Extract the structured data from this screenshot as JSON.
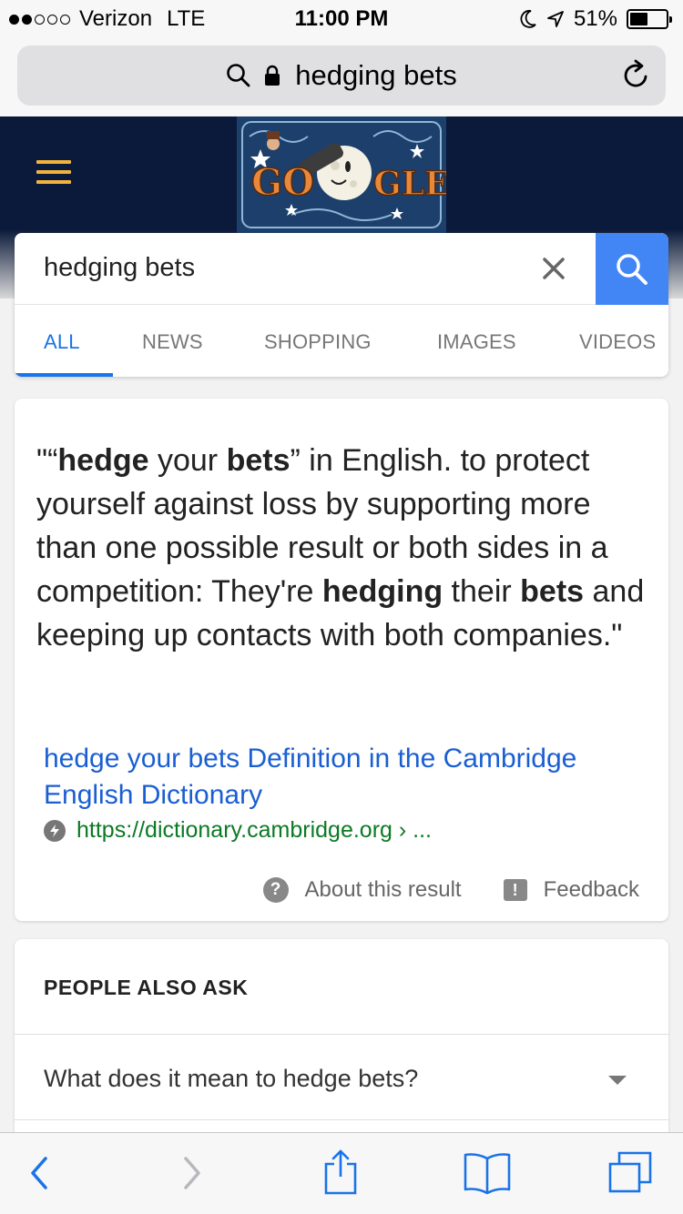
{
  "status_bar": {
    "carrier": "Verizon",
    "network": "LTE",
    "time": "11:00 PM",
    "battery": "51%",
    "battery_level": 0.51,
    "signal_bars_filled": 2,
    "signal_bars_total": 5
  },
  "url_bar": {
    "text": "hedging bets"
  },
  "search": {
    "query": "hedging bets",
    "tabs": [
      "ALL",
      "NEWS",
      "SHOPPING",
      "IMAGES",
      "VIDEOS"
    ],
    "active_tab": "ALL"
  },
  "result": {
    "snippet": {
      "open": "\"“",
      "w1": "hedge",
      "t1": " your ",
      "w2": "bets",
      "t2": "” in English. to protect yourself against loss by supporting more than one possible result or both sides in a competition: They're ",
      "w3": "hedging",
      "t3": " their ",
      "w4": "bets",
      "t4": " and keeping up contacts with both companies.\""
    },
    "link_title": "hedge your bets Definition in the Cambridge English Dictionary",
    "url": "https://dictionary.cambridge.org › ...",
    "about_label": "About this result",
    "feedback_label": "Feedback"
  },
  "people_also_ask": {
    "title": "PEOPLE ALSO ASK",
    "questions": [
      "What does it mean to hedge bets?"
    ]
  },
  "colors": {
    "accent_blue": "#4285f4",
    "link_blue": "#1a5fd2",
    "url_green": "#0b7a24",
    "header_navy": "#0b1a3a",
    "hamburger_gold": "#f1b33b"
  },
  "icons": [
    "search-icon",
    "lock-icon",
    "reload-icon",
    "hamburger-icon",
    "clear-icon",
    "amp-icon",
    "help-icon",
    "feedback-icon",
    "back-icon",
    "forward-icon",
    "share-icon",
    "bookmarks-icon",
    "tabs-icon"
  ]
}
